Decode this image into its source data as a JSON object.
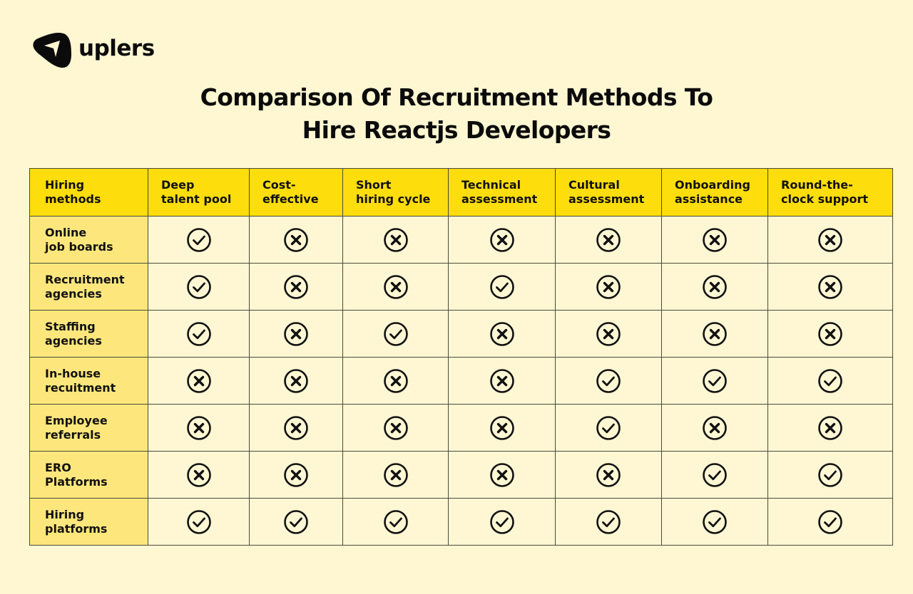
{
  "brand": {
    "name": "uplers",
    "logo_icon": "paper-plane-blob-icon"
  },
  "title": {
    "line1": "Comparison Of Recruitment Methods To",
    "line2": "Hire Reactjs Developers"
  },
  "colors": {
    "background": "#fef7d2",
    "header_fill": "#fddd0b",
    "row_header_fill": "#fde77c",
    "cell_fill": "#fff7d3",
    "border": "#4a4a3c",
    "ink": "#111111"
  },
  "legend": {
    "yes_icon": "check-circle-icon",
    "no_icon": "x-circle-icon"
  },
  "table": {
    "columns": [
      {
        "line1": "Hiring",
        "line2": "methods"
      },
      {
        "line1": "Deep",
        "line2": "talent pool"
      },
      {
        "line1": "Cost-",
        "line2": "effective"
      },
      {
        "line1": "Short",
        "line2": "hiring cycle"
      },
      {
        "line1": "Technical",
        "line2": "assessment"
      },
      {
        "line1": "Cultural",
        "line2": "assessment"
      },
      {
        "line1": "Onboarding",
        "line2": "assistance"
      },
      {
        "line1": "Round-the-",
        "line2": "clock support"
      }
    ],
    "rows": [
      {
        "line1": "Online",
        "line2": "job boards",
        "values": [
          true,
          false,
          false,
          false,
          false,
          false,
          false
        ]
      },
      {
        "line1": "Recruitment",
        "line2": "agencies",
        "values": [
          true,
          false,
          false,
          true,
          false,
          false,
          false
        ]
      },
      {
        "line1": "Staffing",
        "line2": "agencies",
        "values": [
          true,
          false,
          true,
          false,
          false,
          false,
          false
        ]
      },
      {
        "line1": "In-house",
        "line2": "recuitment",
        "values": [
          false,
          false,
          false,
          false,
          true,
          true,
          true
        ]
      },
      {
        "line1": "Employee",
        "line2": "referrals",
        "values": [
          false,
          false,
          false,
          false,
          true,
          false,
          false
        ]
      },
      {
        "line1": "ERO",
        "line2": "Platforms",
        "values": [
          false,
          false,
          false,
          false,
          false,
          true,
          true
        ]
      },
      {
        "line1": "Hiring",
        "line2": "platforms",
        "values": [
          true,
          true,
          true,
          true,
          true,
          true,
          true
        ]
      }
    ]
  }
}
